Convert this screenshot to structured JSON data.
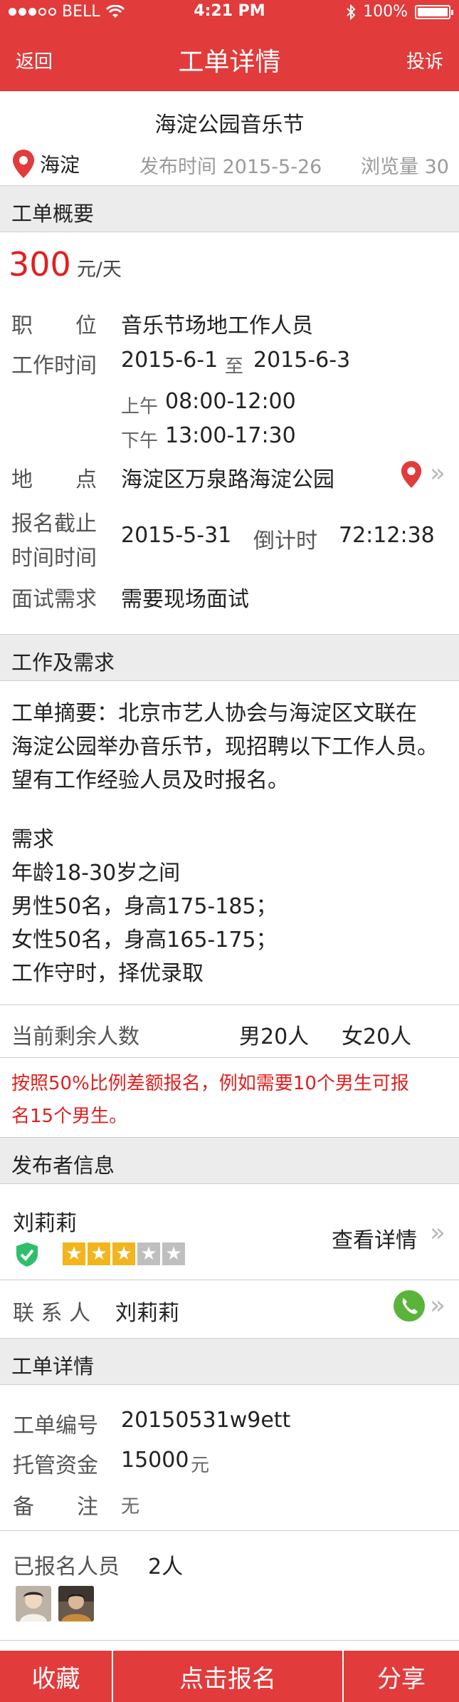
{
  "status_bar": {
    "carrier": "BELL",
    "time": "4:21 PM",
    "battery": "100%",
    "battery_level": 1.0
  },
  "nav": {
    "back": "返回",
    "title": "工单详情",
    "complain": "投诉"
  },
  "header": {
    "event_title": "海淀公园音乐节",
    "location": "海淀",
    "publish_time": "发布时间 2015-5-26",
    "views": "浏览量 30"
  },
  "overview": {
    "section_title": "工单概要",
    "price": "300",
    "price_unit": "元/天",
    "position_label": "职　　位",
    "position_value": "音乐节场地工作人员",
    "work_time_label": "工作时间",
    "date_start": "2015-6-1",
    "date_to": "至",
    "date_end": "2015-6-3",
    "am_label": "上午",
    "am_time": "08:00-12:00",
    "pm_label": "下午",
    "pm_time": "13:00-17:30",
    "address_label": "地　　点",
    "address_value": "海淀区万泉路海淀公园",
    "deadline_label_1": "报名截止",
    "deadline_label_2": "时间时间",
    "deadline_value": "2015-5-31",
    "countdown_label": "倒计时",
    "countdown_value": "72:12:38",
    "interview_label": "面试需求",
    "interview_value": "需要现场面试"
  },
  "requirements": {
    "section_title": "工作及需求",
    "summary_lines": [
      "工单摘要：北京市艺人协会与海淀区文联在",
      "海淀公园举办音乐节，现招聘以下工作人员。",
      "望有工作经验人员及时报名。"
    ],
    "needs_title": "需求",
    "needs_lines": [
      "年龄18-30岁之间",
      "男性50名，身高175-185；",
      "女性50名，身高165-175；",
      "工作守时，择优录取"
    ],
    "remaining_label": "当前剩余人数",
    "remaining_male": "男20人",
    "remaining_female": "女20人",
    "note_lines": [
      "按照50%比例差额报名，例如需要10个男生可报",
      "名15个男生。"
    ]
  },
  "publisher": {
    "section_title": "发布者信息",
    "name": "刘莉莉",
    "rating": 3,
    "rating_max": 5,
    "view_details": "查看详情",
    "contact_label": "联 系 人",
    "contact_name": "刘莉莉"
  },
  "details": {
    "section_title": "工单详情",
    "number_label": "工单编号",
    "number_value": "20150531w9ett",
    "fund_label": "托管资金",
    "fund_value": "15000",
    "fund_unit": "元",
    "remark_label": "备　　注",
    "remark_value": "无"
  },
  "applicants": {
    "label": "已报名人员",
    "count": "2人"
  },
  "tabbar": {
    "favorite": "收藏",
    "apply": "点击报名",
    "share": "分享"
  },
  "colors": {
    "brand_red": "#e23b3b",
    "price_red": "#e02020",
    "verified_green": "#2fbf6b",
    "phone_green": "#5bb43a",
    "star_gold": "#f2b51d"
  }
}
